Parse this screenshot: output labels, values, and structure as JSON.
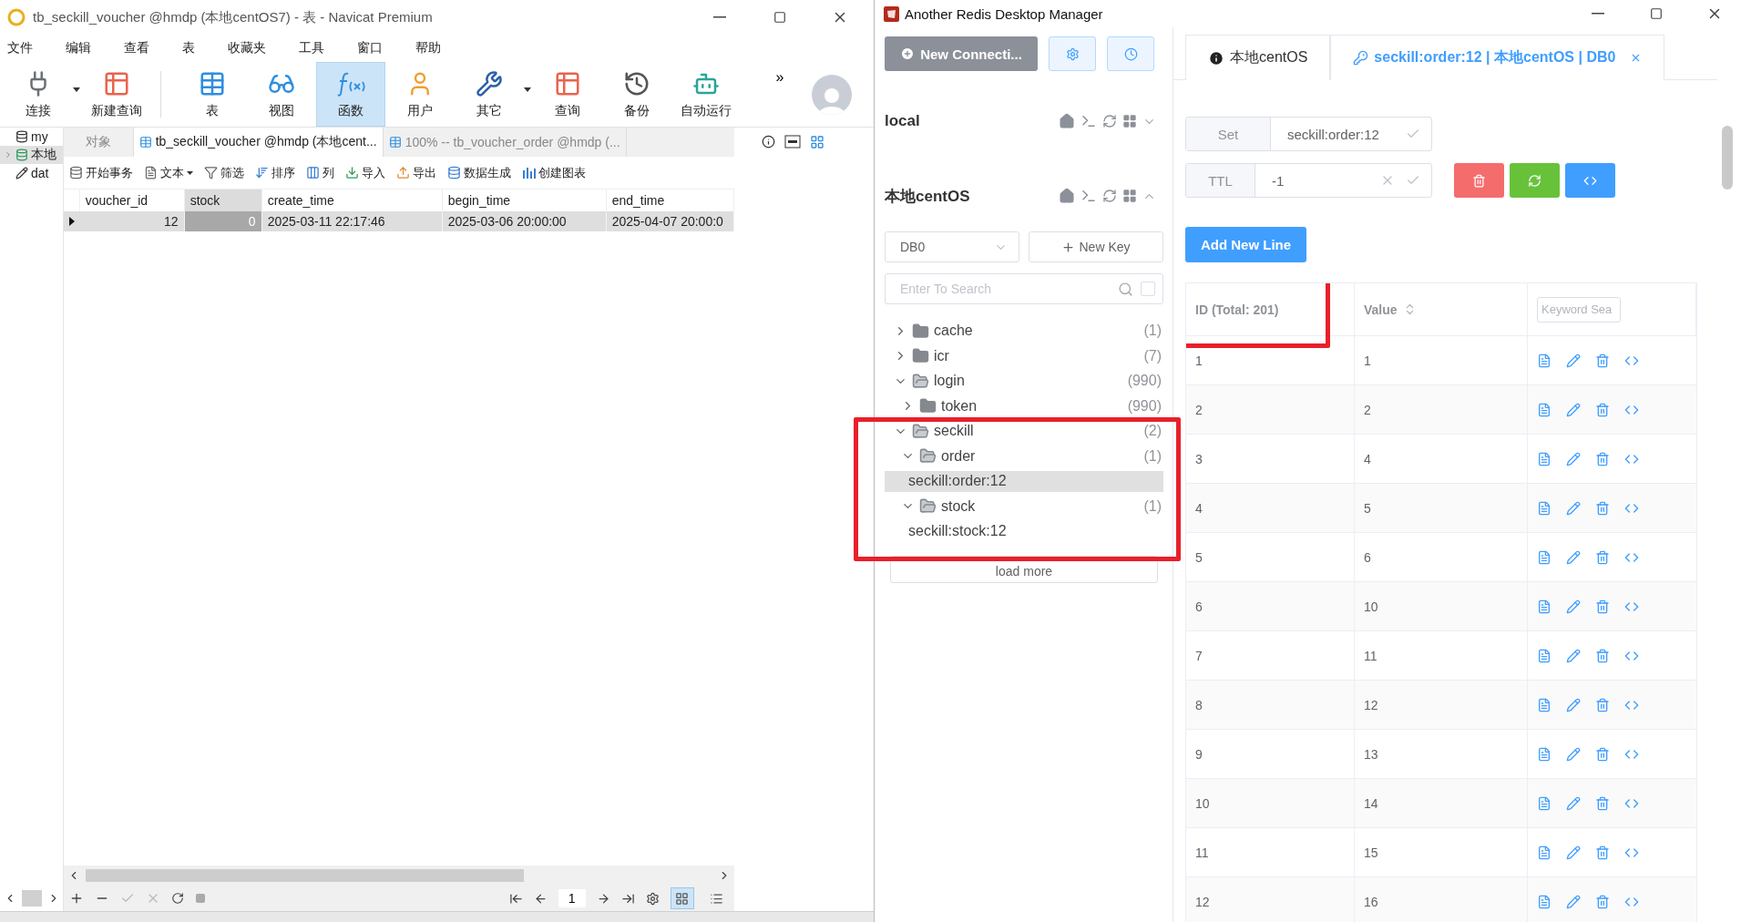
{
  "navicat": {
    "title": "tb_seckill_voucher @hmdp (本地centOS7) - 表 - Navicat Premium",
    "menu": [
      "文件",
      "编辑",
      "查看",
      "表",
      "收藏夹",
      "工具",
      "窗口",
      "帮助"
    ],
    "toolbar": [
      {
        "label": "连接",
        "kind": "plug",
        "selected": false,
        "dropdown": true
      },
      {
        "label": "新建查询",
        "kind": "new-query",
        "selected": false,
        "dropdown": false
      },
      {
        "label": "表",
        "kind": "table",
        "selected": false,
        "dropdown": false
      },
      {
        "label": "视图",
        "kind": "view",
        "selected": false,
        "dropdown": false
      },
      {
        "label": "函数",
        "kind": "function",
        "selected": true,
        "dropdown": false
      },
      {
        "label": "用户",
        "kind": "user",
        "selected": false,
        "dropdown": false
      },
      {
        "label": "其它",
        "kind": "tools",
        "selected": false,
        "dropdown": true
      },
      {
        "label": "查询",
        "kind": "query",
        "selected": false,
        "dropdown": false
      },
      {
        "label": "备份",
        "kind": "backup",
        "selected": false,
        "dropdown": false
      },
      {
        "label": "自动运行",
        "kind": "robot",
        "selected": false,
        "dropdown": false
      }
    ],
    "more": "»",
    "nav_tree": [
      {
        "label": "my",
        "kind": "dolphin",
        "selected": false,
        "expandable": false
      },
      {
        "label": "本地",
        "kind": "dolphin-green",
        "selected": true,
        "expandable": true
      },
      {
        "label": "dat",
        "kind": "pencil",
        "selected": false,
        "expandable": false
      }
    ],
    "tabs": [
      {
        "label": "对象",
        "selected": false,
        "icon": false
      },
      {
        "label": "tb_seckill_voucher @hmdp (本地cent...",
        "selected": true,
        "icon": true
      },
      {
        "label": "100% -- tb_voucher_order @hmdp (...",
        "selected": false,
        "icon": true
      }
    ],
    "actions": [
      {
        "label": "开始事务",
        "kind": "transaction",
        "dropdown": false
      },
      {
        "label": "文本",
        "kind": "text",
        "dropdown": true
      },
      {
        "label": "筛选",
        "kind": "filter",
        "dropdown": false
      },
      {
        "label": "排序",
        "kind": "sort",
        "dropdown": false
      },
      {
        "label": "列",
        "kind": "columns",
        "dropdown": false
      },
      {
        "label": "导入",
        "kind": "import",
        "dropdown": false
      },
      {
        "label": "导出",
        "kind": "export",
        "dropdown": false
      },
      {
        "label": "数据生成",
        "kind": "generate",
        "dropdown": false
      },
      {
        "label": "创建图表",
        "kind": "chart",
        "dropdown": false
      }
    ],
    "grid": {
      "columns": [
        {
          "label": "voucher_id",
          "selected": false
        },
        {
          "label": "stock",
          "selected": true
        },
        {
          "label": "create_time",
          "selected": false
        },
        {
          "label": "begin_time",
          "selected": false
        },
        {
          "label": "end_time",
          "selected": false
        }
      ],
      "rows": [
        {
          "selected": true,
          "cells": [
            "12",
            "0",
            "2025-03-11 22:17:46",
            "2025-03-06 20:00:00",
            "2025-04-07 20:00:0"
          ]
        }
      ]
    },
    "page": "1",
    "views": [
      {
        "kind": "grid",
        "selected": true
      },
      {
        "kind": "form",
        "selected": false
      }
    ]
  },
  "redis": {
    "title": "Another Redis Desktop Manager",
    "new_connection": "New Connecti...",
    "connections": [
      {
        "name": "local",
        "expanded": false
      },
      {
        "name": "本地centOS",
        "expanded": true
      }
    ],
    "db": "DB0",
    "new_key": "New Key",
    "search_placeholder": "Enter To Search",
    "search_option_checked": false,
    "tree": [
      {
        "kind": "folder",
        "label": "cache",
        "count": "(1)",
        "expanded": false
      },
      {
        "kind": "folder",
        "label": "icr",
        "count": "(7)",
        "expanded": false
      },
      {
        "kind": "folder",
        "label": "login",
        "count": "(990)",
        "expanded": true,
        "children": [
          {
            "kind": "folder",
            "label": "token",
            "count": "(990)",
            "expanded": false
          }
        ]
      },
      {
        "kind": "folder",
        "label": "seckill",
        "count": "(2)",
        "expanded": true,
        "highlight": true,
        "children": [
          {
            "kind": "folder",
            "label": "order",
            "count": "(1)",
            "expanded": true,
            "children": [
              {
                "kind": "key",
                "label": "seckill:order:12",
                "selected": true
              }
            ]
          },
          {
            "kind": "folder",
            "label": "stock",
            "count": "(1)",
            "expanded": true,
            "children": [
              {
                "kind": "key",
                "label": "seckill:stock:12",
                "selected": false
              }
            ]
          }
        ]
      }
    ],
    "load_more": "load more",
    "tabs": [
      {
        "kind": "info",
        "label": "本地centOS",
        "selected": false,
        "closable": false
      },
      {
        "kind": "key",
        "label": "seckill:order:12 | 本地centOS | DB0",
        "selected": true,
        "closable": true
      }
    ],
    "key_type": "Set",
    "key_name": "seckill:order:12",
    "ttl_label": "TTL",
    "ttl": "-1",
    "add_line": "Add New Line",
    "table": {
      "id_header": "ID (Total: 201)",
      "id_highlight": true,
      "value_header": "Value",
      "keyword_placeholder": "Keyword Sea",
      "rows": [
        {
          "id": "1",
          "value": "1"
        },
        {
          "id": "2",
          "value": "2"
        },
        {
          "id": "3",
          "value": "4"
        },
        {
          "id": "4",
          "value": "5"
        },
        {
          "id": "5",
          "value": "6"
        },
        {
          "id": "6",
          "value": "10"
        },
        {
          "id": "7",
          "value": "11"
        },
        {
          "id": "8",
          "value": "12"
        },
        {
          "id": "9",
          "value": "13"
        },
        {
          "id": "10",
          "value": "14"
        },
        {
          "id": "11",
          "value": "15"
        },
        {
          "id": "12",
          "value": "16"
        }
      ]
    }
  }
}
